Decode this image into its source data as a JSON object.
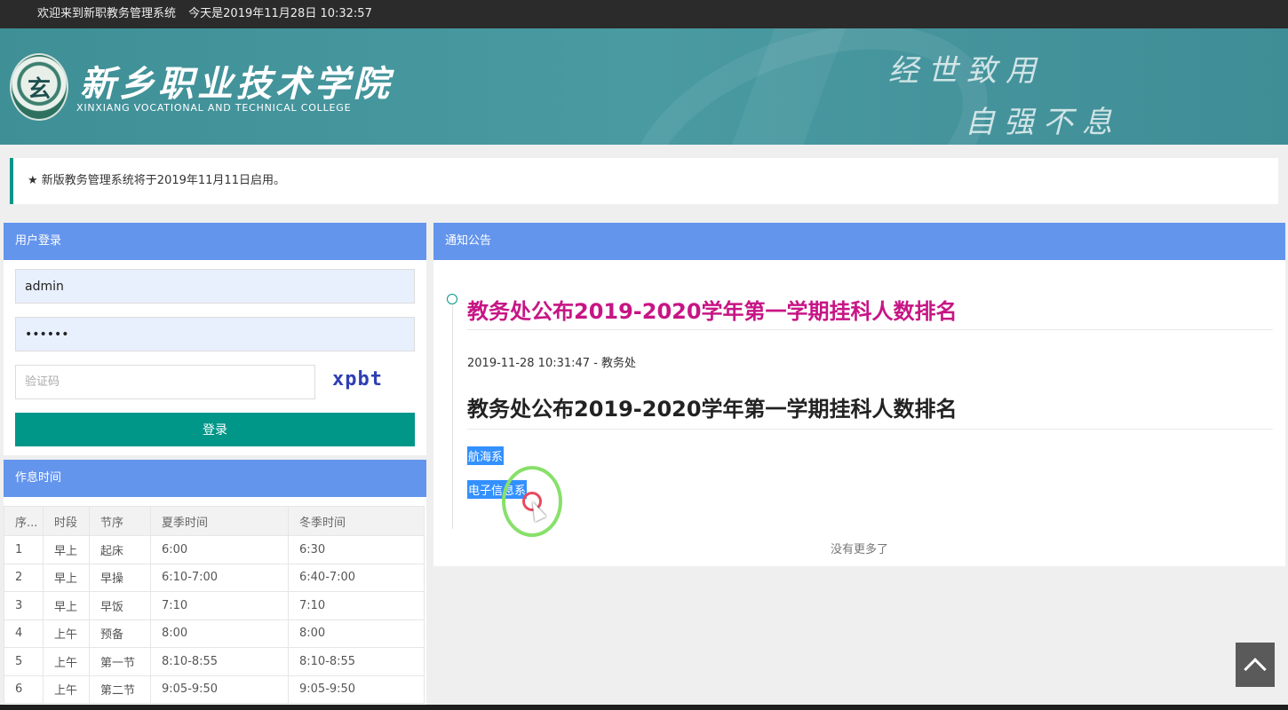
{
  "topbar": {
    "welcome": "欢迎来到新职教务管理系统",
    "datetime": "今天是2019年11月28日 10:32:57"
  },
  "banner": {
    "logo_glyph": "玄",
    "college_cn": "新乡职业技术学院",
    "college_en": "XINXIANG VOCATIONAL AND TECHNICAL COLLEGE",
    "motto_line1": "经世致用",
    "motto_line2": "自强不息"
  },
  "notice": {
    "star": "★",
    "text": "新版教务管理系统将于2019年11月11日启用。"
  },
  "login": {
    "title": "用户登录",
    "username_value": "admin",
    "password_value": "••••••",
    "captcha_placeholder": "验证码",
    "captcha_text": "xpbt",
    "submit_label": "登录"
  },
  "schedule": {
    "title": "作息时间",
    "columns": [
      "序...",
      "时段",
      "节序",
      "夏季时间",
      "冬季时间"
    ],
    "rows": [
      [
        "1",
        "早上",
        "起床",
        "6:00",
        "6:30"
      ],
      [
        "2",
        "早上",
        "早操",
        "6:10-7:00",
        "6:40-7:00"
      ],
      [
        "3",
        "早上",
        "早饭",
        "7:10",
        "7:10"
      ],
      [
        "4",
        "上午",
        "预备",
        "8:00",
        "8:00"
      ],
      [
        "5",
        "上午",
        "第一节",
        "8:10-8:55",
        "8:10-8:55"
      ],
      [
        "6",
        "上午",
        "第二节",
        "9:05-9:50",
        "9:05-9:50"
      ]
    ]
  },
  "news": {
    "title": "通知公告",
    "item_title": "教务处公布2019-2020学年第一学期挂科人数排名",
    "meta": "2019-11-28 10:31:47 - 教务处",
    "content_title": "教务处公布2019-2020学年第一学期挂科人数排名",
    "departments": [
      "航海系",
      "电子信息系"
    ],
    "no_more": "没有更多了"
  },
  "colors": {
    "header_blue": "#6495ed",
    "accent_teal": "#009688",
    "title_magenta": "#c71585",
    "banner_teal": "#4a9aa2"
  }
}
